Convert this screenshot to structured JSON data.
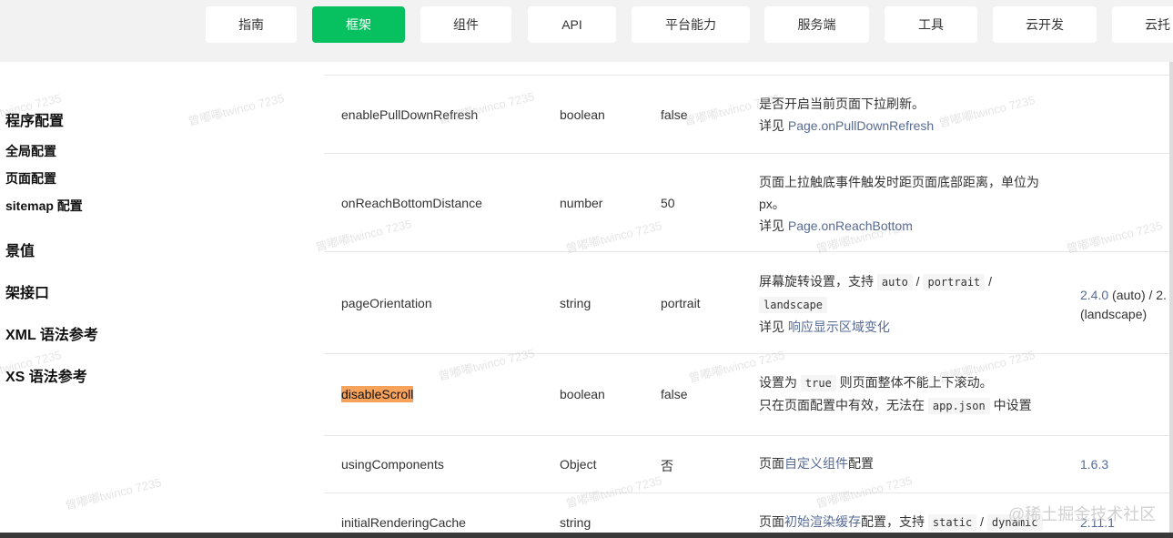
{
  "nav": {
    "tabs": [
      {
        "label": "指南"
      },
      {
        "label": "框架",
        "active": true
      },
      {
        "label": "组件"
      },
      {
        "label": "API"
      },
      {
        "label": "平台能力"
      },
      {
        "label": "服务端"
      },
      {
        "label": "工具"
      },
      {
        "label": "云开发"
      },
      {
        "label": "云托"
      }
    ]
  },
  "sidebar": {
    "items": [
      {
        "label": "程序配置"
      },
      {
        "label": "全局配置"
      },
      {
        "label": "页面配置"
      },
      {
        "label": "sitemap 配置"
      },
      {
        "label": "景值"
      },
      {
        "label": "架接口"
      },
      {
        "label": "XML 语法参考"
      },
      {
        "label": "XS 语法参考"
      }
    ]
  },
  "table": {
    "rows": [
      {
        "property": "enablePullDownRefresh",
        "type": "boolean",
        "default": "false",
        "desc_line1": "是否开启当前页面下拉刷新。",
        "desc_prefix": "详见 ",
        "desc_link": "Page.onPullDownRefresh"
      },
      {
        "property": "onReachBottomDistance",
        "type": "number",
        "default": "50",
        "desc_line1": "页面上拉触底事件触发时距页面底部距离，单位为",
        "desc_line2": "px。",
        "desc_prefix": "详见 ",
        "desc_link": "Page.onReachBottom"
      },
      {
        "property": "pageOrientation",
        "type": "string",
        "default": "portrait",
        "desc_text": "屏幕旋转设置，支持 ",
        "code_auto": "auto",
        "sep": " / ",
        "code_portrait": "portrait",
        "code_landscape": "landscape",
        "desc_prefix": "详见 ",
        "desc_link": "响应显示区域变化",
        "version_link": "2.4.0",
        "version_text": " (auto) / 2.",
        "version_line2": "(landscape)"
      },
      {
        "property": "disableScroll",
        "type": "boolean",
        "default": "false",
        "desc_a": "设置为 ",
        "code_true": "true",
        "desc_b": " 则页面整体不能上下滚动。",
        "desc_c": "只在页面配置中有效，无法在 ",
        "code_app": "app.json",
        "desc_d": " 中设置"
      },
      {
        "property": "usingComponents",
        "type": "Object",
        "default": "否",
        "desc_pre": "页面",
        "desc_link": "自定义组件",
        "desc_post": "配置",
        "version": "1.6.3"
      },
      {
        "property": "initialRenderingCache",
        "type": "string",
        "desc_pre": "页面",
        "desc_link": "初始渲染缓存",
        "desc_post": "配置，支持 ",
        "code_static": "static",
        "sep": " / ",
        "code_dynamic": "dynamic",
        "version": "2.11.1"
      }
    ]
  },
  "watermark": "曾嘟嘟twinco 7235",
  "credit": "@稀土掘金技术社区"
}
